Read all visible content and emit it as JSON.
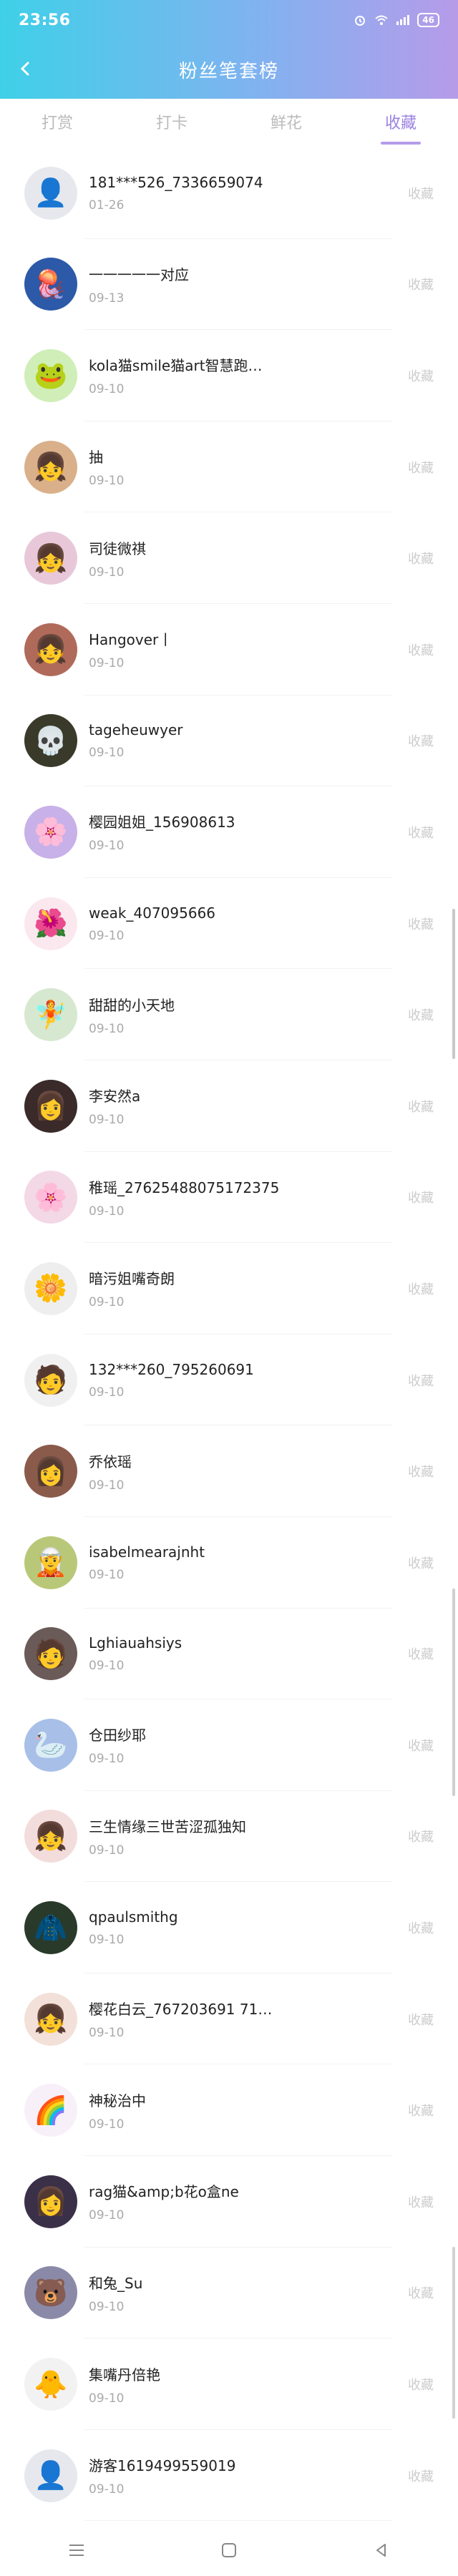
{
  "status_bar": {
    "time": "23:56",
    "battery": "46"
  },
  "header": {
    "title": "粉丝笔套榜"
  },
  "tabs": [
    {
      "label": "打赏",
      "active": false
    },
    {
      "label": "打卡",
      "active": false
    },
    {
      "label": "鲜花",
      "active": false
    },
    {
      "label": "收藏",
      "active": true
    }
  ],
  "colors": {
    "accent": "#9b82e0",
    "gradient_start": "#3fd0e8",
    "gradient_end": "#b69be9"
  },
  "rows": [
    {
      "name": "181***526_7336659074",
      "date": "01-26",
      "status": "收藏",
      "avatar_color": "#e6e8ee",
      "avatar_glyph": "👤"
    },
    {
      "name": "一一一一一对应",
      "date": "09-13",
      "status": "收藏",
      "avatar_color": "#2c5aa8",
      "avatar_glyph": "🪼"
    },
    {
      "name": "kola猫smile猫art智慧跑…",
      "date": "09-10",
      "status": "收藏",
      "avatar_color": "#cfeeb8",
      "avatar_glyph": "🐸"
    },
    {
      "name": "抽",
      "date": "09-10",
      "status": "收藏",
      "avatar_color": "#d9b08a",
      "avatar_glyph": "👧"
    },
    {
      "name": "司徒微祺",
      "date": "09-10",
      "status": "收藏",
      "avatar_color": "#e8c8d8",
      "avatar_glyph": "👧"
    },
    {
      "name": "Hangover丨",
      "date": "09-10",
      "status": "收藏",
      "avatar_color": "#b06a5a",
      "avatar_glyph": "👧"
    },
    {
      "name": "tageheuwyer",
      "date": "09-10",
      "status": "收藏",
      "avatar_color": "#3a3a2a",
      "avatar_glyph": "💀"
    },
    {
      "name": "樱园姐姐_156908613",
      "date": "09-10",
      "status": "收藏",
      "avatar_color": "#c8b0e8",
      "avatar_glyph": "🌸"
    },
    {
      "name": "weak_407095666",
      "date": "09-10",
      "status": "收藏",
      "avatar_color": "#fbe8ee",
      "avatar_glyph": "🌺"
    },
    {
      "name": "甜甜的小天地",
      "date": "09-10",
      "status": "收藏",
      "avatar_color": "#d6e8d0",
      "avatar_glyph": "🧚"
    },
    {
      "name": "李安然a",
      "date": "09-10",
      "status": "收藏",
      "avatar_color": "#3a2a2a",
      "avatar_glyph": "👩"
    },
    {
      "name": "稚瑶_27625488075172375",
      "date": "09-10",
      "status": "收藏",
      "avatar_color": "#f3d8e6",
      "avatar_glyph": "🌸"
    },
    {
      "name": "暗污姐嘴奇朗",
      "date": "09-10",
      "status": "收藏",
      "avatar_color": "#eeeeee",
      "avatar_glyph": "🌼"
    },
    {
      "name": "132***260_795260691",
      "date": "09-10",
      "status": "收藏",
      "avatar_color": "#f0f0f0",
      "avatar_glyph": "🧑"
    },
    {
      "name": "乔依瑶",
      "date": "09-10",
      "status": "收藏",
      "avatar_color": "#8a5a4a",
      "avatar_glyph": "👩"
    },
    {
      "name": "isabelmearajnht",
      "date": "09-10",
      "status": "收藏",
      "avatar_color": "#b8c878",
      "avatar_glyph": "🧝"
    },
    {
      "name": "Lghiauahsiys",
      "date": "09-10",
      "status": "收藏",
      "avatar_color": "#6a5a58",
      "avatar_glyph": "🧑"
    },
    {
      "name": "仓田纱耶",
      "date": "09-10",
      "status": "收藏",
      "avatar_color": "#a8c0e8",
      "avatar_glyph": "🦢"
    },
    {
      "name": "三生情缘三世苦涩孤独知",
      "date": "09-10",
      "status": "收藏",
      "avatar_color": "#f3dcdc",
      "avatar_glyph": "👧"
    },
    {
      "name": "qpaulsmithg",
      "date": "09-10",
      "status": "收藏",
      "avatar_color": "#2a3a2a",
      "avatar_glyph": "🧥"
    },
    {
      "name": "樱花白云_767203691 71…",
      "date": "09-10",
      "status": "收藏",
      "avatar_color": "#f3e0d8",
      "avatar_glyph": "👧"
    },
    {
      "name": "神秘治中",
      "date": "09-10",
      "status": "收藏",
      "avatar_color": "#f8f0f8",
      "avatar_glyph": "🌈"
    },
    {
      "name": "rag猫&amp;b花o盒ne",
      "date": "09-10",
      "status": "收藏",
      "avatar_color": "#3a3048",
      "avatar_glyph": "👩"
    },
    {
      "name": "和兔_Su",
      "date": "09-10",
      "status": "收藏",
      "avatar_color": "#8a8aa8",
      "avatar_glyph": "🐻"
    },
    {
      "name": "集嘴丹倍艳",
      "date": "09-10",
      "status": "收藏",
      "avatar_color": "#f2f2f2",
      "avatar_glyph": "🐥"
    },
    {
      "name": "游客1619499559019",
      "date": "09-10",
      "status": "收藏",
      "avatar_color": "#e6e8ee",
      "avatar_glyph": "👤"
    }
  ]
}
